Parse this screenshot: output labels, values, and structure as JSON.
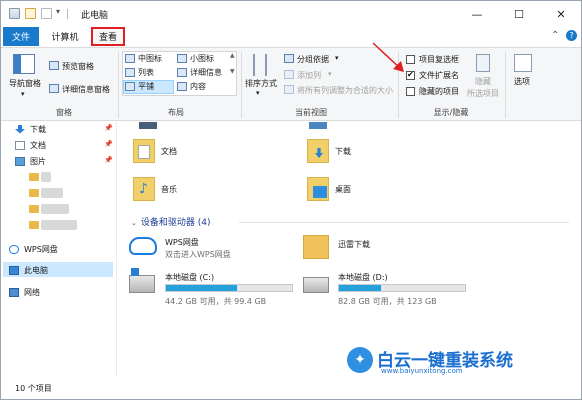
{
  "window": {
    "title": "此电脑",
    "minimize": "—",
    "maximize": "☐",
    "close": "✕",
    "collapse_ribbon": "⌃",
    "help": "?"
  },
  "tabs": {
    "file": "文件",
    "computer": "计算机",
    "view": "查看"
  },
  "ribbon": {
    "pane_group": {
      "nav_pane": "导航窗格",
      "preview": "预览窗格",
      "details": "详细信息窗格",
      "label": "窗格"
    },
    "layout_group": {
      "items": [
        "中图标",
        "小图标",
        "列表",
        "详细信息",
        "平铺",
        "内容"
      ],
      "label": "布局"
    },
    "view_group": {
      "sort": "排序方式",
      "groupby": "分组依据",
      "addcol": "添加列",
      "fit": "将所有列调整为合适的大小",
      "label": "当前视图"
    },
    "showhide_group": {
      "item_check": "项目复选框",
      "file_ext": "文件扩展名",
      "hidden_items": "隐藏的项目",
      "hide": "隐藏",
      "hide_sub": "所选项目",
      "label": "显示/隐藏",
      "file_ext_checked": true
    },
    "options": "选项"
  },
  "nav": {
    "downloads": "下载",
    "documents": "文档",
    "pictures": "图片",
    "wps": "WPS网盘",
    "this_pc": "此电脑",
    "network": "网络"
  },
  "folders": {
    "documents": "文档",
    "downloads": "下载",
    "music": "音乐",
    "desktop": "桌面"
  },
  "section": "设备和驱动器 (4)",
  "devices": {
    "wps": {
      "name": "WPS网盘",
      "sub": "双击进入WPS网盘"
    },
    "xunlei": {
      "name": "迅雷下载"
    },
    "c": {
      "name": "本地磁盘 (C:)",
      "sub": "44.2 GB 可用，共 99.4 GB",
      "used": 0.56
    },
    "d": {
      "name": "本地磁盘 (D:)",
      "sub": "82.8 GB 可用，共 123 GB",
      "used": 0.33
    }
  },
  "status": {
    "count": "10 个项目"
  },
  "watermark": {
    "brand": "白云一键重装系统",
    "url": "www.baiyunxitong.com"
  },
  "colors": {
    "accent": "#1979ca",
    "red_highlight": "#e02020",
    "progress": "#26a0da"
  }
}
